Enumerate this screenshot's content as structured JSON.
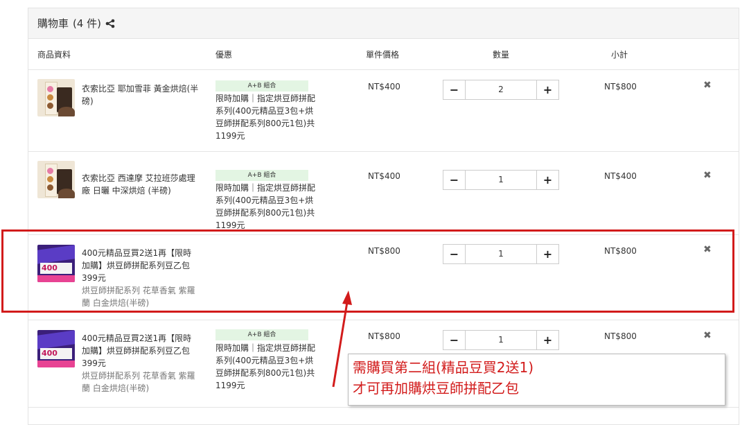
{
  "cart": {
    "title": "購物車",
    "count_label": "(4 件)"
  },
  "columns": {
    "product": "商品資料",
    "promo": "優惠",
    "unit_price": "單件價格",
    "quantity": "數量",
    "subtotal": "小計"
  },
  "items": [
    {
      "name": "衣索比亞 耶加雪菲 黃金烘焙(半磅)",
      "variant": "",
      "badge": "A+B 組合",
      "promo": "限時加購｜指定烘豆師拼配系列(400元精品豆3包+烘豆師拼配系列800元1包)共1199元",
      "price": "NT$400",
      "qty": "2",
      "subtotal": "NT$800"
    },
    {
      "name": "衣索比亞 西達摩 艾拉班莎處理廠 日曬 中深烘焙 (半磅)",
      "variant": "",
      "badge": "A+B 組合",
      "promo": "限時加購｜指定烘豆師拼配系列(400元精品豆3包+烘豆師拼配系列800元1包)共1199元",
      "price": "NT$400",
      "qty": "1",
      "subtotal": "NT$400"
    },
    {
      "name": "400元精品豆買2送1再【限時加購】烘豆師拼配系列豆乙包399元",
      "variant": "烘豆師拼配系列 花草香氣 紫羅蘭 白金烘焙(半磅)",
      "badge": "",
      "promo": "",
      "price": "NT$800",
      "qty": "1",
      "subtotal": "NT$800"
    },
    {
      "name": "400元精品豆買2送1再【限時加購】烘豆師拼配系列豆乙包399元",
      "variant": "烘豆師拼配系列 花草香氣 紫羅蘭 白金烘焙(半磅)",
      "badge": "A+B 組合",
      "promo": "限時加購｜指定烘豆師拼配系列(400元精品豆3包+烘豆師拼配系列800元1包)共1199元",
      "price": "NT$800",
      "qty": "1",
      "subtotal": "NT$800"
    }
  ],
  "thumb_text": "400",
  "annotation": {
    "line1": "需購買第二組(精品豆買2送1)",
    "line2": "才可再加購烘豆師拼配乙包",
    "color": "#d21b1b"
  },
  "icons": {
    "share": "share-icon",
    "minus": "minus-icon",
    "plus": "plus-icon",
    "remove": "close-icon"
  }
}
